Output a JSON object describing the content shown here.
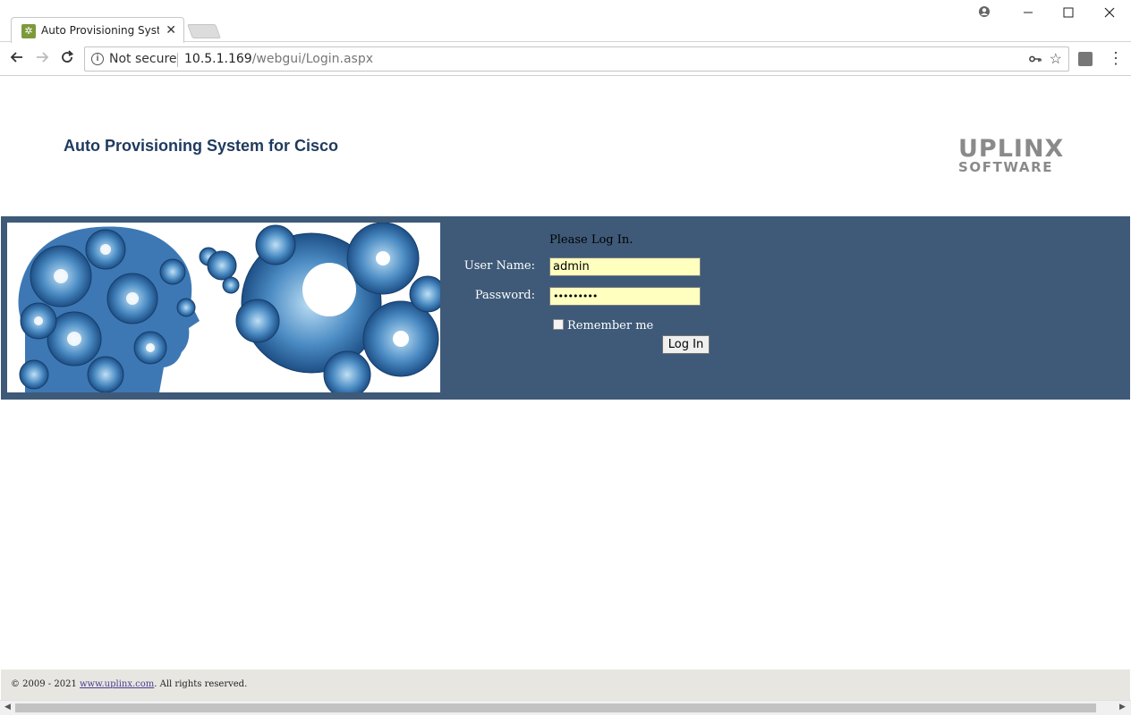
{
  "browser": {
    "tab_title": "Auto Provisioning System for Cisco",
    "security_label": "Not secure",
    "url_host": "10.5.1.169",
    "url_path": "/webgui/Login.aspx"
  },
  "header": {
    "title": "Auto Provisioning System for Cisco",
    "logo_top": "UPLINX",
    "logo_bottom": "SOFTWARE"
  },
  "login": {
    "heading": "Please Log In.",
    "username_label": "User Name:",
    "username_value": "admin",
    "password_label": "Password:",
    "password_mask": "•••••••••",
    "remember_label": "Remember me",
    "remember_checked": false,
    "button_label": "Log In"
  },
  "footer": {
    "copyright_prefix": "© 2009 - 2021 ",
    "link_text": "www.uplinx.com",
    "copyright_suffix": ". All rights reserved."
  },
  "colors": {
    "band": "#3e5a78",
    "title": "#1f3a5e",
    "field_bg": "#ffffc0",
    "footer_bg": "#e7e6e1"
  }
}
